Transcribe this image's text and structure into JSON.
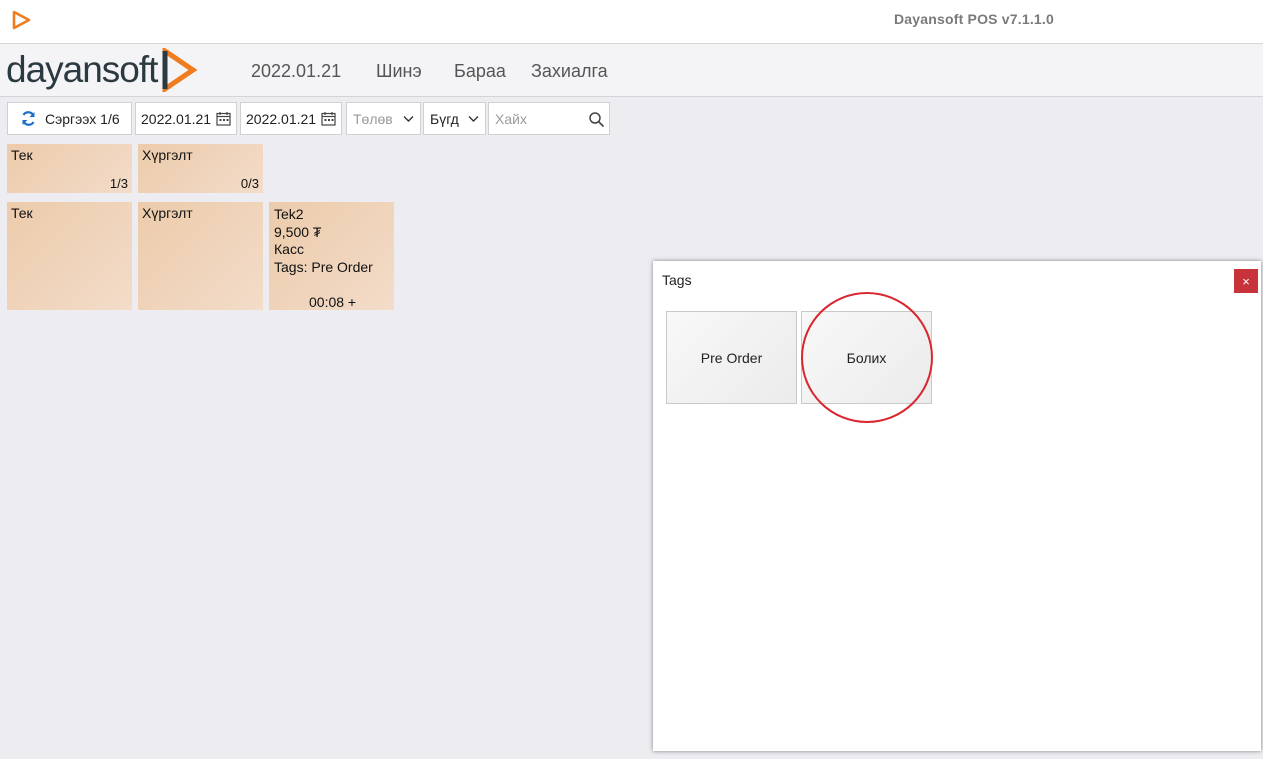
{
  "window": {
    "title": "Dayansoft POS v7.1.1.0",
    "app_icon": "play-triangle-icon"
  },
  "header": {
    "logo_text": "dayansoft",
    "date": "2022.01.21",
    "nav": [
      "Шинэ",
      "Бараа",
      "Захиалга"
    ]
  },
  "toolbar": {
    "refresh_label": "Сэргээх 1/6",
    "date_from": "2022.01.21",
    "date_to": "2022.01.21",
    "status_placeholder": "Төлөв",
    "filter_value": "Бүгд",
    "search_placeholder": "Хайх"
  },
  "groups": [
    {
      "title": "Тек",
      "count": "1/3"
    },
    {
      "title": "Хүргэлт",
      "count": "0/3"
    }
  ],
  "columns": [
    {
      "title": "Тек"
    },
    {
      "title": "Хүргэлт"
    }
  ],
  "order": {
    "name": "Tek2",
    "amount": "9,500 ₮",
    "user": "Касс",
    "tags": "Tags: Pre Order",
    "time": "00:08 +"
  },
  "dialog": {
    "title": "Tags",
    "close": "×",
    "buttons": [
      "Pre Order",
      "Болих"
    ]
  },
  "colors": {
    "accent_orange": "#ef7d1f",
    "tile_bg": "#eccbaa",
    "close_red": "#c8323a",
    "highlight_red": "#d9262f",
    "refresh_blue": "#1a6ec8"
  }
}
